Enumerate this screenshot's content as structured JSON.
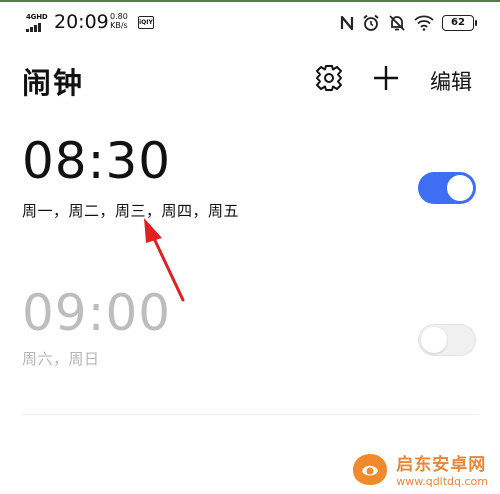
{
  "status_bar": {
    "network_label": "4GHD",
    "time": "20:09",
    "speed_value": "0.80",
    "speed_unit": "KB/s",
    "app_badge": "iQIY",
    "battery": "62"
  },
  "header": {
    "title": "闹钟",
    "edit_label": "编辑"
  },
  "alarms": [
    {
      "time": "08:30",
      "days": "周一，周二，周三，周四，周五",
      "enabled": true
    },
    {
      "time": "09:00",
      "days": "周六，周日",
      "enabled": false
    }
  ],
  "watermark": {
    "name": "启东安卓网",
    "url": "www.qdltdq.com"
  },
  "colors": {
    "accent": "#3d6ef3",
    "annotation_arrow": "#e02020",
    "disabled_text": "#bdbdbd"
  }
}
